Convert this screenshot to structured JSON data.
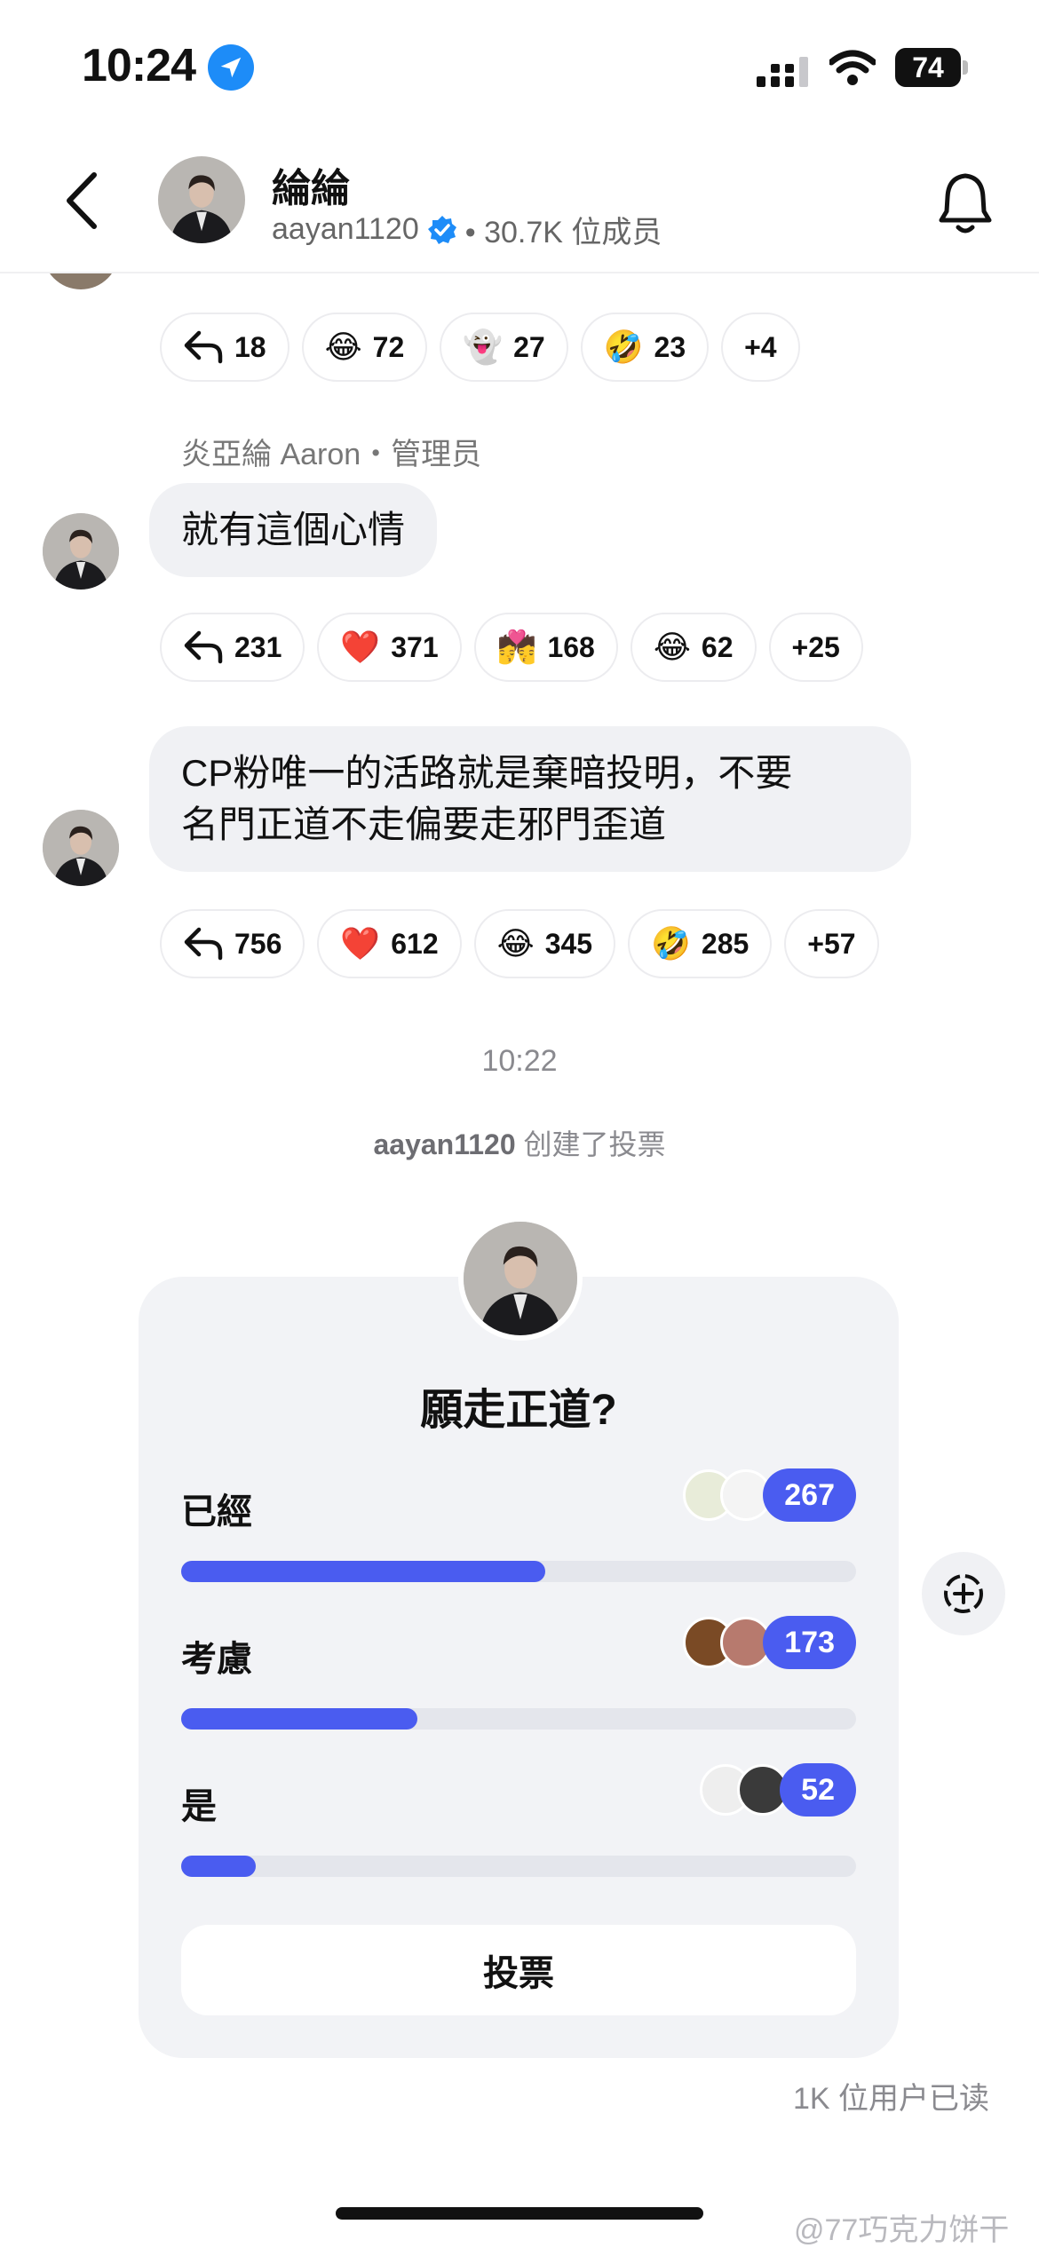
{
  "status_bar": {
    "time": "10:24",
    "battery": "74"
  },
  "header": {
    "title": "綸綸",
    "handle": "aayan1120",
    "members": "• 30.7K 位成员"
  },
  "messages": [
    {
      "sender": "",
      "text": "",
      "reactions": [
        {
          "icon": "reply-icon",
          "count": "18"
        },
        {
          "emoji": "😂",
          "count": "72"
        },
        {
          "emoji": "👻",
          "count": "27"
        },
        {
          "emoji": "🤣",
          "count": "23"
        },
        {
          "more": "+4"
        }
      ]
    },
    {
      "sender": "炎亞綸 Aaron・管理员",
      "text": "就有這個心情",
      "reactions": [
        {
          "icon": "reply-icon",
          "count": "231"
        },
        {
          "emoji": "❤️",
          "count": "371"
        },
        {
          "emoji": "💏",
          "count": "168"
        },
        {
          "emoji": "😂",
          "count": "62"
        },
        {
          "more": "+25"
        }
      ]
    },
    {
      "sender": "",
      "text_line1": "CP粉唯一的活路就是棄暗投明，不要",
      "text_line2": "名門正道不走偏要走邪門歪道",
      "reactions": [
        {
          "icon": "reply-icon",
          "count": "756"
        },
        {
          "emoji": "❤️",
          "count": "612"
        },
        {
          "emoji": "😂",
          "count": "345"
        },
        {
          "emoji": "🤣",
          "count": "285"
        },
        {
          "more": "+57"
        }
      ]
    }
  ],
  "timestamp": "10:22",
  "poll_note": {
    "user": "aayan1120",
    "action": " 创建了投票"
  },
  "poll": {
    "question": "願走正道?",
    "options": [
      {
        "label": "已經",
        "votes": "267",
        "fraction": 0.54
      },
      {
        "label": "考慮",
        "votes": "173",
        "fraction": 0.35
      },
      {
        "label": "是",
        "votes": "52",
        "fraction": 0.11
      }
    ],
    "vote_label": "投票"
  },
  "read_receipt": "1K 位用户已读",
  "watermark": "@77巧克力饼干",
  "colors": {
    "accent": "#4a5cf0",
    "bubble": "#f0f1f4",
    "verified": "#1d8cf8"
  }
}
